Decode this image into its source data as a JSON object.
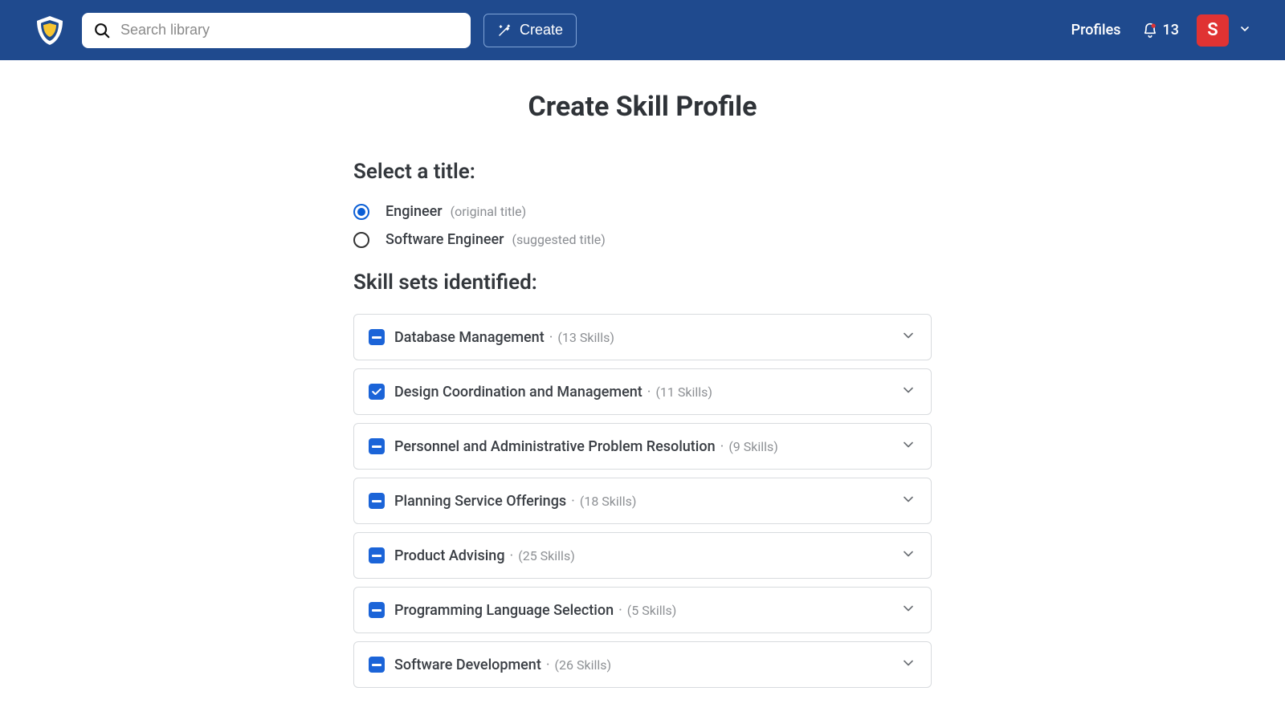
{
  "header": {
    "search_placeholder": "Search library",
    "create_label": "Create",
    "profiles_label": "Profiles",
    "notification_count": "13",
    "avatar_letter": "S"
  },
  "page": {
    "title": "Create Skill Profile",
    "select_title_label": "Select a title:",
    "skill_sets_label": "Skill sets identified:"
  },
  "titles": [
    {
      "label": "Engineer",
      "hint": "(original title)",
      "selected": true
    },
    {
      "label": "Software Engineer",
      "hint": "(suggested title)",
      "selected": false
    }
  ],
  "skill_sets": [
    {
      "name": "Database Management",
      "count": "(13 Skills)",
      "state": "indeterminate"
    },
    {
      "name": "Design Coordination and Management",
      "count": "(11 Skills)",
      "state": "checked"
    },
    {
      "name": "Personnel and Administrative Problem Resolution",
      "count": "(9 Skills)",
      "state": "indeterminate"
    },
    {
      "name": "Planning Service Offerings",
      "count": "(18 Skills)",
      "state": "indeterminate"
    },
    {
      "name": "Product Advising",
      "count": "(25 Skills)",
      "state": "indeterminate"
    },
    {
      "name": "Programming Language Selection",
      "count": "(5 Skills)",
      "state": "indeterminate"
    },
    {
      "name": "Software Development",
      "count": "(26 Skills)",
      "state": "indeterminate"
    }
  ]
}
